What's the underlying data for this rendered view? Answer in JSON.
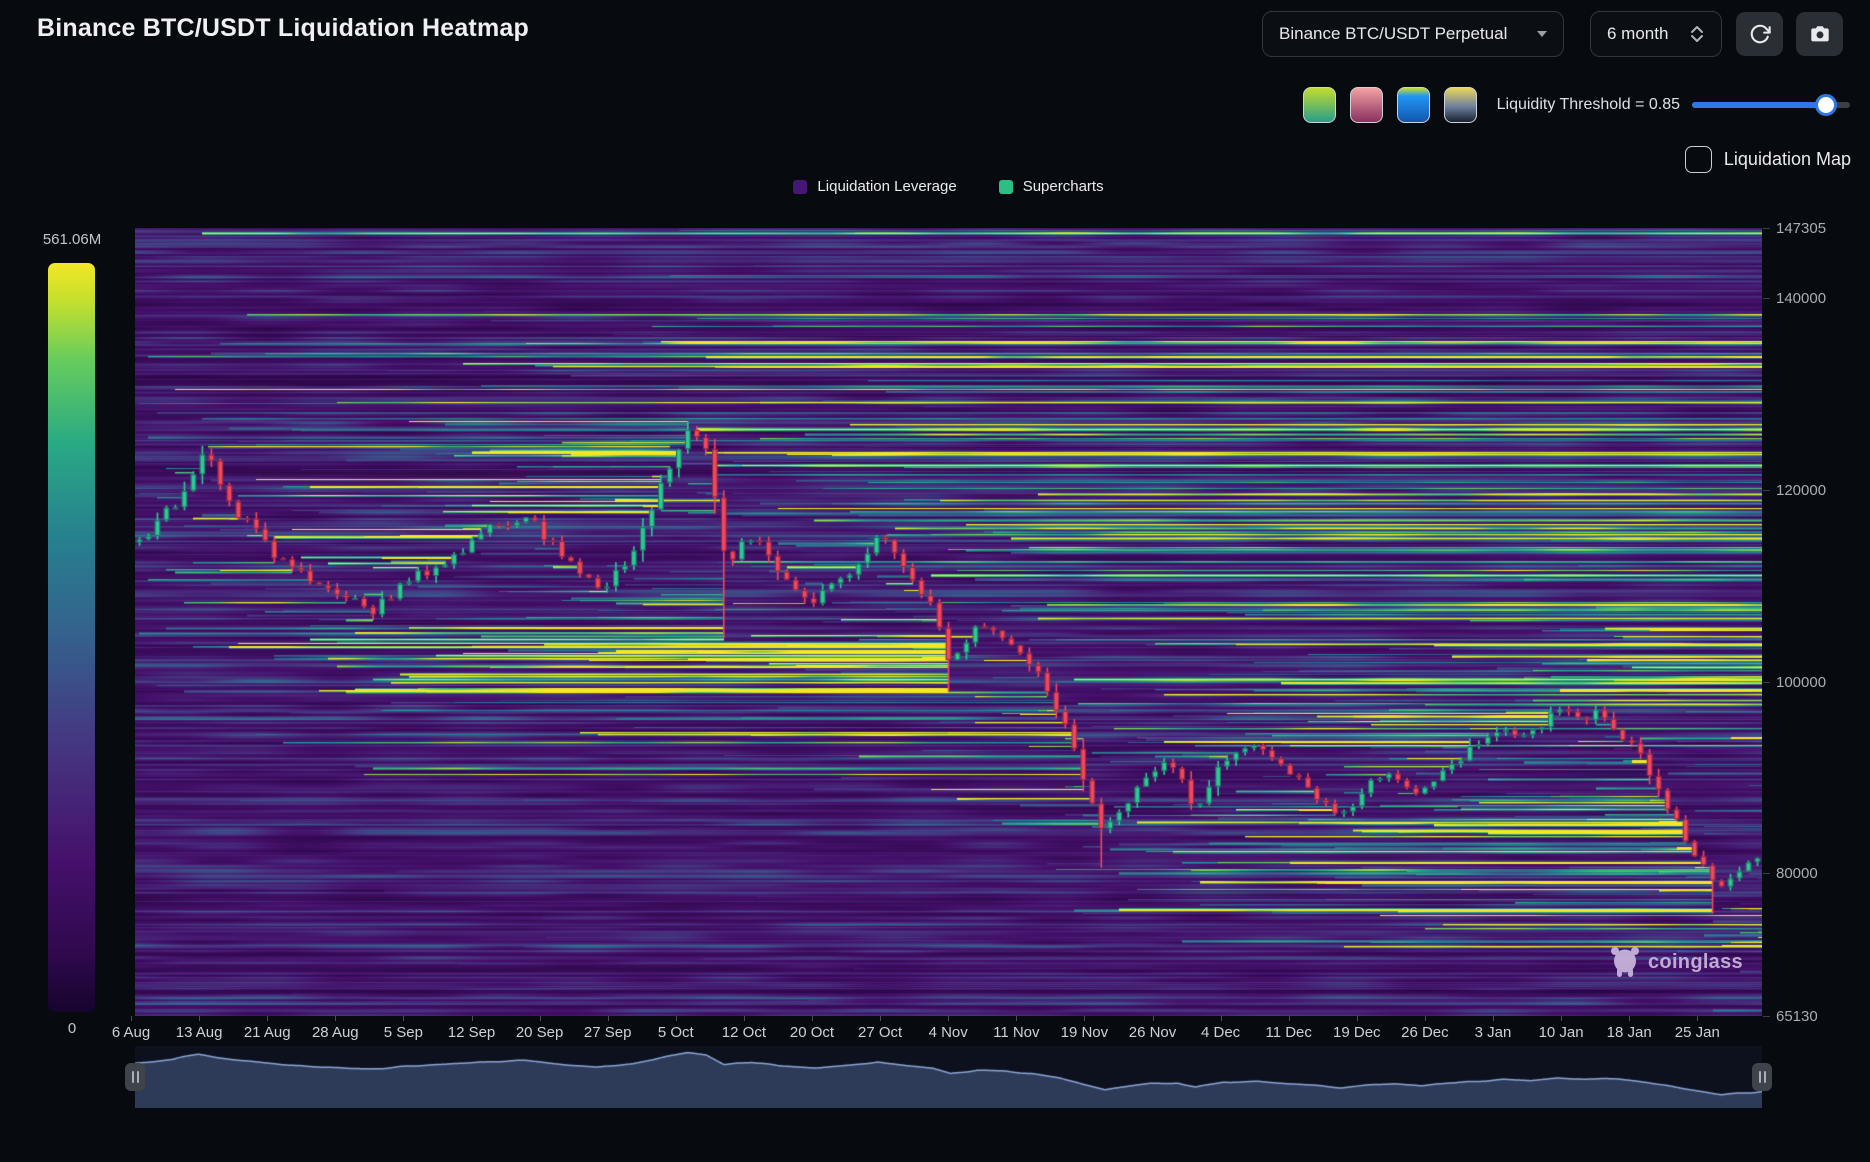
{
  "header": {
    "title": "Binance BTC/USDT Liquidation Heatmap",
    "pair_selector": "Binance BTC/USDT Perpetual",
    "timeframe_selector": "6 month"
  },
  "toolbar": {
    "threshold_label": "Liquidity Threshold = 0.85",
    "threshold_value": 0.85,
    "slider_color": "#2e77e6",
    "liquidation_map_label": "Liquidation Map",
    "palette_swatches": [
      {
        "name": "green-teal",
        "stops": [
          [
            "#c2dc2f",
            0
          ],
          [
            "#2a9d8a",
            100
          ]
        ]
      },
      {
        "name": "rose",
        "stops": [
          [
            "#f2a3a3",
            0
          ],
          [
            "#8a3060",
            100
          ]
        ]
      },
      {
        "name": "blue",
        "stops": [
          [
            "#c6de2e",
            0
          ],
          [
            "#2196f3",
            24
          ],
          [
            "#1256b0",
            100
          ]
        ]
      },
      {
        "name": "gold-navy",
        "stops": [
          [
            "#e8d75c",
            0
          ],
          [
            "#6d7f9e",
            55
          ],
          [
            "#18222f",
            100
          ]
        ]
      }
    ]
  },
  "legend": {
    "items": [
      {
        "label": "Liquidation Leverage",
        "color": "#451672"
      },
      {
        "label": "Supercharts",
        "color": "#2ebd85"
      }
    ]
  },
  "colorbar": {
    "max_label": "561.06M",
    "min_label": "0"
  },
  "watermark": {
    "text": "coinglass"
  },
  "chart_data": {
    "type": "heatmap",
    "subtype": "liquidation-heatmap-with-candlestick-overlay",
    "title": "Binance BTC/USDT Liquidation Heatmap",
    "x_labels": [
      "6 Aug",
      "13 Aug",
      "21 Aug",
      "28 Aug",
      "5 Sep",
      "12 Sep",
      "20 Sep",
      "27 Sep",
      "5 Oct",
      "12 Oct",
      "20 Oct",
      "27 Oct",
      "4 Nov",
      "11 Nov",
      "19 Nov",
      "26 Nov",
      "4 Dec",
      "11 Dec",
      "19 Dec",
      "26 Dec",
      "3 Jan",
      "10 Jan",
      "18 Jan",
      "25 Jan"
    ],
    "y_ticks": [
      147305,
      140000,
      120000,
      100000,
      80000,
      65130
    ],
    "y_range": [
      65130,
      147305
    ],
    "intensity_range": [
      "0",
      "561.06M"
    ],
    "days_span": 179.5,
    "candle_up_color": "#2fc896",
    "candle_down_color": "#f4465d",
    "palette": [
      [
        "#16042e",
        0
      ],
      [
        "#30094e",
        0.08
      ],
      [
        "#45106b",
        0.2
      ],
      [
        "#453781",
        0.36
      ],
      [
        "#34608d",
        0.5
      ],
      [
        "#26828e",
        0.64
      ],
      [
        "#2aaa84",
        0.76
      ],
      [
        "#66cc5d",
        0.87
      ],
      [
        "#c4e02c",
        0.95
      ],
      [
        "#f5e626",
        1
      ]
    ],
    "price_path": [
      [
        0,
        114500
      ],
      [
        4,
        118500
      ],
      [
        7,
        124000
      ],
      [
        11,
        117500
      ],
      [
        15,
        113500
      ],
      [
        19,
        110200
      ],
      [
        23,
        108600
      ],
      [
        26,
        107300
      ],
      [
        30,
        110500
      ],
      [
        34,
        112500
      ],
      [
        38,
        115800
      ],
      [
        43,
        117200
      ],
      [
        47,
        112800
      ],
      [
        51,
        109300
      ],
      [
        55,
        113800
      ],
      [
        58,
        120500
      ],
      [
        61,
        126200
      ],
      [
        63,
        123500
      ],
      [
        65,
        112000
      ],
      [
        68,
        115300
      ],
      [
        71,
        111000
      ],
      [
        75,
        108500
      ],
      [
        79,
        111500
      ],
      [
        82,
        115500
      ],
      [
        85,
        111000
      ],
      [
        88,
        107500
      ],
      [
        90,
        101500
      ],
      [
        93,
        106000
      ],
      [
        96,
        105000
      ],
      [
        99,
        101500
      ],
      [
        102,
        97000
      ],
      [
        104,
        92000
      ],
      [
        107,
        84000
      ],
      [
        110,
        88000
      ],
      [
        112,
        91000
      ],
      [
        115,
        91500
      ],
      [
        117,
        86500
      ],
      [
        120,
        92000
      ],
      [
        124,
        93500
      ],
      [
        127,
        91000
      ],
      [
        130,
        88500
      ],
      [
        133,
        85500
      ],
      [
        136,
        89000
      ],
      [
        139,
        90500
      ],
      [
        142,
        88000
      ],
      [
        145,
        91500
      ],
      [
        148,
        93000
      ],
      [
        151,
        95000
      ],
      [
        154,
        94000
      ],
      [
        157,
        97500
      ],
      [
        160,
        95500
      ],
      [
        162,
        97000
      ],
      [
        165,
        94000
      ],
      [
        167,
        91500
      ],
      [
        169,
        88000
      ],
      [
        171,
        84500
      ],
      [
        173,
        81500
      ],
      [
        175,
        78500
      ],
      [
        177,
        80000
      ],
      [
        179.5,
        81500
      ]
    ],
    "spikes": [
      {
        "d": 7,
        "high": 124600
      },
      {
        "d": 61,
        "high": 126400
      },
      {
        "d": 65,
        "low": 104500
      },
      {
        "d": 90,
        "low": 99000
      },
      {
        "d": 107,
        "low": 80600
      },
      {
        "d": 175,
        "low": 75800
      }
    ],
    "liquidity_bands": [
      {
        "price": 126300,
        "from_day": 62,
        "strength": 1.0,
        "width": 3
      },
      {
        "price": 123900,
        "from_day": 63,
        "strength": 0.72,
        "width": 2
      },
      {
        "price": 121600,
        "from_day": 64,
        "strength": 0.5,
        "width": 2
      },
      {
        "price": 124600,
        "from_day": 8,
        "to_day": 59,
        "strength": 0.85,
        "width": 2
      },
      {
        "price": 118900,
        "from_day": 53,
        "to_day": 64.5,
        "strength": 1.0,
        "width": 3
      },
      {
        "price": 117800,
        "from_day": 34,
        "to_day": 57,
        "strength": 0.8,
        "width": 2
      },
      {
        "price": 112600,
        "from_day": 66,
        "strength": 0.55,
        "width": 2
      },
      {
        "price": 115400,
        "from_day": 83,
        "strength": 0.45,
        "width": 2
      },
      {
        "price": 97800,
        "from_day": 104,
        "strength": 0.6,
        "width": 2
      },
      {
        "price": 95200,
        "from_day": 108,
        "strength": 0.55,
        "width": 2
      },
      {
        "price": 93400,
        "from_day": 117,
        "strength": 0.5,
        "width": 2
      },
      {
        "price": 87000,
        "from_day": 108,
        "to_day": 146,
        "strength": 0.5,
        "width": 2
      }
    ],
    "texture_seed": 20
  },
  "navigator": {
    "bg": "#0c111d",
    "fill": "#2d3a58",
    "line": "#8ca6d8",
    "price_window": [
      73000,
      128000
    ]
  }
}
